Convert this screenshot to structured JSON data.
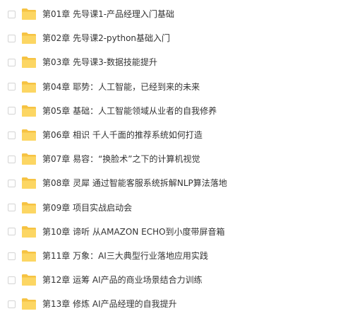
{
  "colors": {
    "folder_back": "#f6c343",
    "folder_front": "#fcd663",
    "text": "#333333",
    "checkbox_border": "#d4d4d4"
  },
  "items": [
    {
      "label": "第01章 先导课1-产品经理入门基础",
      "icon": "folder-icon"
    },
    {
      "label": "第02章 先导课2-python基础入门",
      "icon": "folder-icon"
    },
    {
      "label": "第03章 先导课3-数据技能提升",
      "icon": "folder-icon"
    },
    {
      "label": "第04章 耶势：人工智能，已经到来的未来",
      "icon": "folder-icon"
    },
    {
      "label": "第05章 基础：人工智能领域从业者的自我修养",
      "icon": "folder-icon"
    },
    {
      "label": "第06章 相识 千人千面的推荐系统如何打造",
      "icon": "folder-icon"
    },
    {
      "label": "第07章 易容：“换脸术”之下的计算机视觉",
      "icon": "folder-icon"
    },
    {
      "label": "第08章 灵犀 通过智能客服系统拆解NLP算法落地",
      "icon": "folder-icon"
    },
    {
      "label": "第09章 项目实战启动会",
      "icon": "folder-icon"
    },
    {
      "label": "第10章 谛听 从AMAZON ECHO到小度带屏音箱",
      "icon": "folder-icon"
    },
    {
      "label": "第11章 万象：AI三大典型行业落地应用实践",
      "icon": "folder-icon"
    },
    {
      "label": "第12章 运筹 AI产品的商业场景结合力训练",
      "icon": "folder-icon"
    },
    {
      "label": "第13章 修炼 AI产品经理的自我提升",
      "icon": "folder-icon"
    }
  ]
}
